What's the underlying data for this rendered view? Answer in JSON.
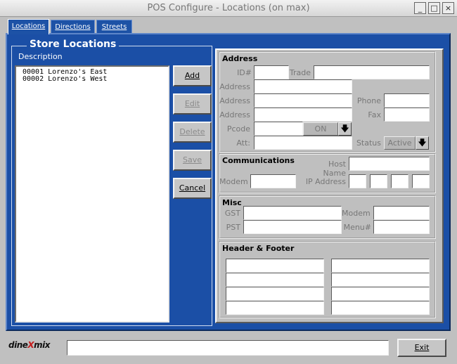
{
  "window": {
    "title": "POS Configure - Locations (on max)",
    "minimize_glyph": "_",
    "maximize_glyph": "□",
    "close_glyph": "×"
  },
  "tabs": [
    {
      "label": "Locations",
      "active": true
    },
    {
      "label": "Directions",
      "active": false
    },
    {
      "label": "Streets",
      "active": false
    }
  ],
  "store_locations": {
    "title": "Store Locations",
    "column_label": "Description",
    "items": [
      "00001 Lorenzo's East",
      "00002 Lorenzo's West"
    ]
  },
  "buttons": {
    "add": "Add",
    "edit": "Edit",
    "delete": "Delete",
    "save": "Save",
    "cancel": "Cancel",
    "exit": "Exit"
  },
  "address": {
    "title": "Address",
    "id_label": "ID#",
    "trade_label": "Trade",
    "address_label": "Address",
    "phone_label": "Phone",
    "fax_label": "Fax",
    "pcode_label": "Pcode",
    "pcode_button": "ON",
    "att_label": "Att:",
    "status_label": "Status",
    "status_value": "Active"
  },
  "communications": {
    "title": "Communications",
    "host_name_label": "Host Name",
    "modem_label": "Modem",
    "ip_address_label": "IP Address"
  },
  "misc": {
    "title": "Misc",
    "gst_label": "GST",
    "pst_label": "PST",
    "modem_label": "Modem",
    "menu_label": "Menu#"
  },
  "header_footer": {
    "title": "Header & Footer"
  },
  "logo": {
    "text_left": "dine",
    "text_x": "X",
    "text_right": "mix"
  },
  "colors": {
    "panel_blue": "#1b4fa6",
    "window_gray": "#c0c0c0",
    "logo_red": "#c41a1a"
  }
}
